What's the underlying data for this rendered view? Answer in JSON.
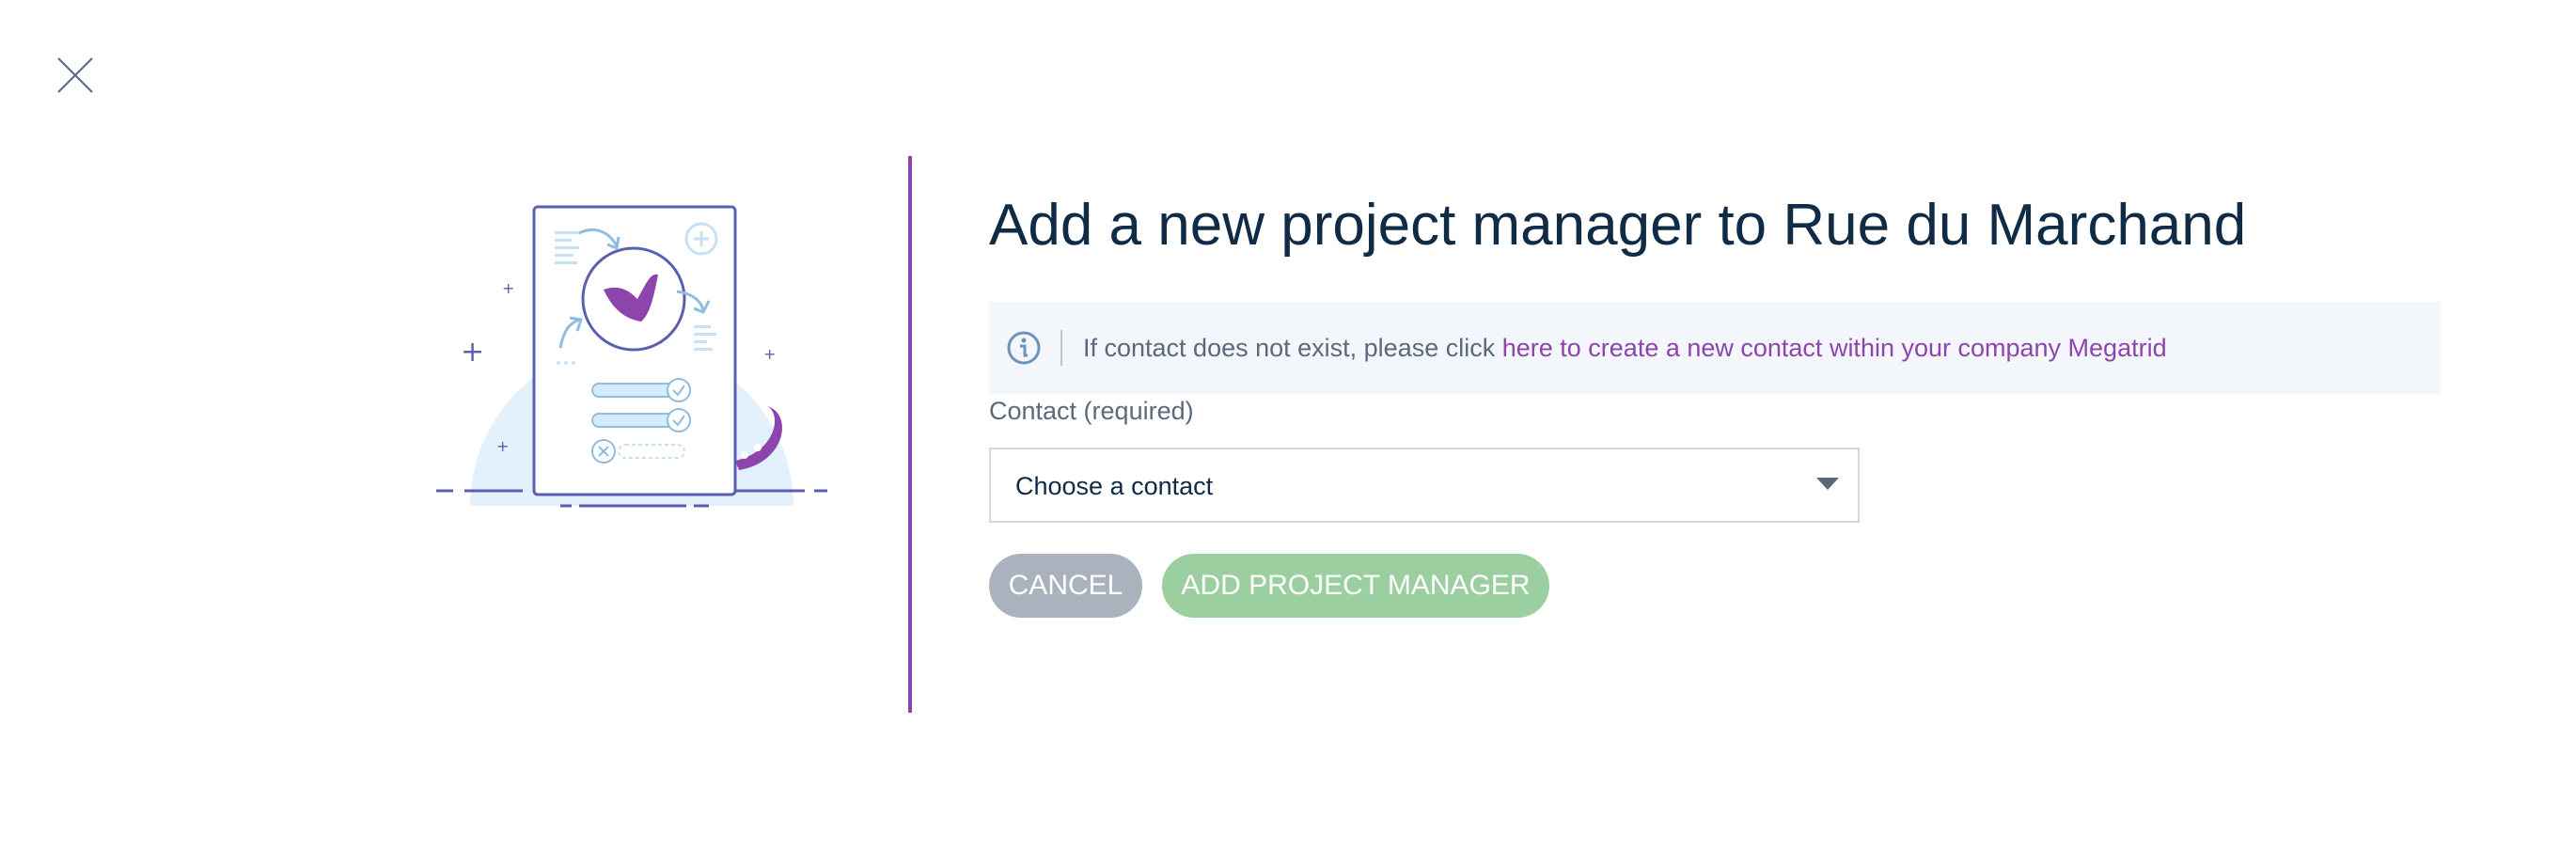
{
  "dialog": {
    "title": "Add a new project manager to Rue du Marchand"
  },
  "info": {
    "text": "If contact does not exist, please click ",
    "link_text": "here to create a new contact within your company Megatrid"
  },
  "contact_field": {
    "label": "Contact (required)",
    "selected_value": "Choose a contact"
  },
  "actions": {
    "cancel_label": "CANCEL",
    "add_label": "ADD PROJECT MANAGER"
  },
  "colors": {
    "accent": "#8e44ad",
    "title_text": "#102b45",
    "cancel_bg": "#aab3bd",
    "add_bg": "#9ccf9f",
    "info_bg": "#f3f7fb"
  },
  "icons": [
    "close-icon",
    "info-icon",
    "chevron-down-icon"
  ]
}
